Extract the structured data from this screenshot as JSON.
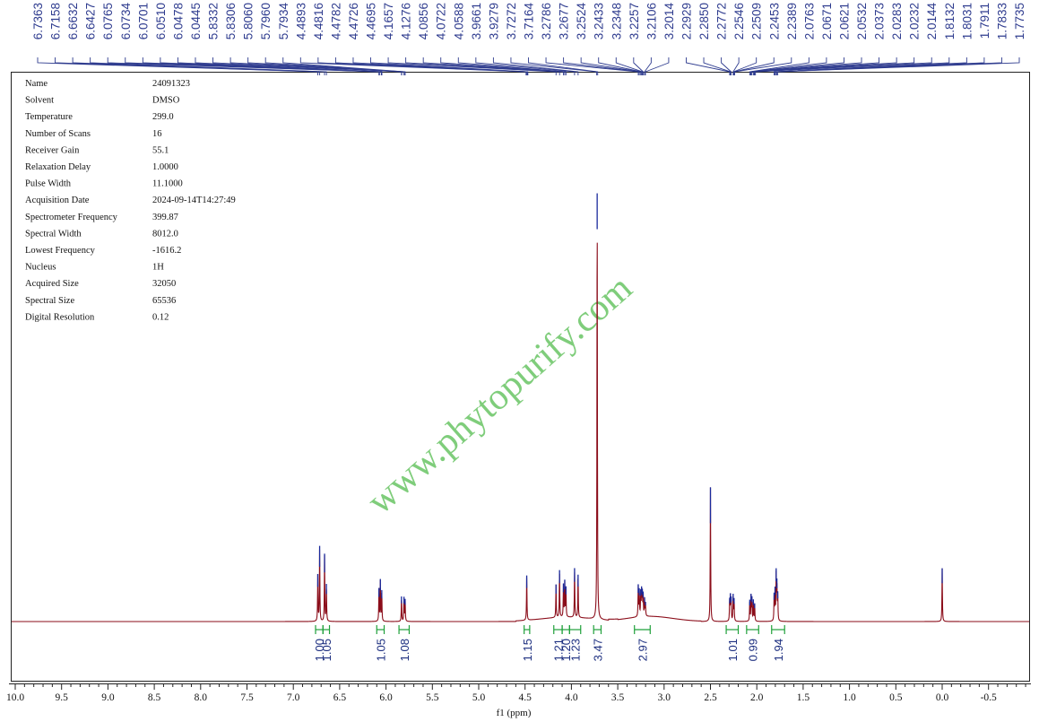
{
  "chart_data": {
    "type": "line",
    "title": "",
    "xlabel": "f1 (ppm)",
    "ylabel": "",
    "x_axis": {
      "range": [
        10.0,
        -1.0
      ],
      "reversed": true,
      "tick_labels": [
        "10.0",
        "9.5",
        "9.0",
        "8.5",
        "8.0",
        "7.5",
        "7.0",
        "6.5",
        "6.0",
        "5.5",
        "5.0",
        "4.5",
        "4.0",
        "3.5",
        "3.0",
        "2.5",
        "2.0",
        "1.5",
        "1.0",
        "0.5",
        "0.0",
        "-0.5"
      ]
    },
    "grid": false,
    "spectrum_color": "#8b0d1a",
    "peak_tip_color": "#1a2a9c",
    "peak_label_color": "#2f3c8f",
    "integration_color": "#1fa03a",
    "peak_labels": [
      "6.7363",
      "6.7158",
      "6.6632",
      "6.6427",
      "6.0765",
      "6.0734",
      "6.0701",
      "6.0510",
      "6.0478",
      "6.0445",
      "5.8332",
      "5.8306",
      "5.8060",
      "5.7960",
      "5.7934",
      "4.4893",
      "4.4816",
      "4.4782",
      "4.4726",
      "4.4695",
      "4.1657",
      "4.1276",
      "4.0856",
      "4.0722",
      "4.0588",
      "3.9661",
      "3.9279",
      "3.7272",
      "3.7164",
      "3.2786",
      "3.2677",
      "3.2524",
      "3.2433",
      "3.2348",
      "3.2257",
      "3.2106",
      "3.2014",
      "2.2929",
      "2.2850",
      "2.2772",
      "2.2546",
      "2.2509",
      "2.2453",
      "2.2389",
      "2.0763",
      "2.0671",
      "2.0621",
      "2.0532",
      "2.0373",
      "2.0283",
      "2.0232",
      "2.0144",
      "1.8132",
      "1.8031",
      "1.7911",
      "1.7833",
      "1.7735"
    ],
    "peaks": [
      {
        "ppm": 6.736,
        "height": 0.108
      },
      {
        "ppm": 6.716,
        "height": 0.175
      },
      {
        "ppm": 6.663,
        "height": 0.157
      },
      {
        "ppm": 6.643,
        "height": 0.085
      },
      {
        "ppm": 6.076,
        "height": 0.075
      },
      {
        "ppm": 6.061,
        "height": 0.095
      },
      {
        "ppm": 6.046,
        "height": 0.07
      },
      {
        "ppm": 5.833,
        "height": 0.058
      },
      {
        "ppm": 5.806,
        "height": 0.055
      },
      {
        "ppm": 5.794,
        "height": 0.05
      },
      {
        "ppm": 4.482,
        "height": 0.105
      },
      {
        "ppm": 4.166,
        "height": 0.077
      },
      {
        "ppm": 4.128,
        "height": 0.11
      },
      {
        "ppm": 4.086,
        "height": 0.075
      },
      {
        "ppm": 4.072,
        "height": 0.082
      },
      {
        "ppm": 4.059,
        "height": 0.068
      },
      {
        "ppm": 3.966,
        "height": 0.115
      },
      {
        "ppm": 3.928,
        "height": 0.1
      },
      {
        "ppm": 3.722,
        "height": 1.0
      },
      {
        "ppm": 3.279,
        "height": 0.072
      },
      {
        "ppm": 3.268,
        "height": 0.06
      },
      {
        "ppm": 3.252,
        "height": 0.055
      },
      {
        "ppm": 3.243,
        "height": 0.058
      },
      {
        "ppm": 3.235,
        "height": 0.052
      },
      {
        "ppm": 3.226,
        "height": 0.05
      },
      {
        "ppm": 3.211,
        "height": 0.04
      },
      {
        "ppm": 3.201,
        "height": 0.03
      },
      {
        "ppm": 2.5,
        "height": 0.315
      },
      {
        "ppm": 2.293,
        "height": 0.048
      },
      {
        "ppm": 2.285,
        "height": 0.055
      },
      {
        "ppm": 2.277,
        "height": 0.05
      },
      {
        "ppm": 2.255,
        "height": 0.06
      },
      {
        "ppm": 2.245,
        "height": 0.05
      },
      {
        "ppm": 2.076,
        "height": 0.048
      },
      {
        "ppm": 2.062,
        "height": 0.058
      },
      {
        "ppm": 2.053,
        "height": 0.052
      },
      {
        "ppm": 2.037,
        "height": 0.048
      },
      {
        "ppm": 2.023,
        "height": 0.04
      },
      {
        "ppm": 1.813,
        "height": 0.06
      },
      {
        "ppm": 1.803,
        "height": 0.07
      },
      {
        "ppm": 1.791,
        "height": 0.11
      },
      {
        "ppm": 1.783,
        "height": 0.082
      },
      {
        "ppm": 1.774,
        "height": 0.06
      },
      {
        "ppm": 0.0,
        "height": 0.125
      }
    ],
    "integrations": [
      {
        "label": "1.00",
        "from": 6.76,
        "to": 6.68
      },
      {
        "label": "1.05",
        "from": 6.68,
        "to": 6.61
      },
      {
        "label": "1.05",
        "from": 6.1,
        "to": 6.02
      },
      {
        "label": "1.08",
        "from": 5.86,
        "to": 5.75
      },
      {
        "label": "1.15",
        "from": 4.51,
        "to": 4.45
      },
      {
        "label": "1.21",
        "from": 4.19,
        "to": 4.1
      },
      {
        "label": "1.20",
        "from": 4.1,
        "to": 4.02
      },
      {
        "label": "1.23",
        "from": 4.02,
        "to": 3.9
      },
      {
        "label": "3.47",
        "from": 3.76,
        "to": 3.68
      },
      {
        "label": "2.97",
        "from": 3.32,
        "to": 3.15
      },
      {
        "label": "1.01",
        "from": 2.33,
        "to": 2.2
      },
      {
        "label": "0.99",
        "from": 2.11,
        "to": 1.98
      },
      {
        "label": "1.94",
        "from": 1.84,
        "to": 1.7
      }
    ]
  },
  "parameters": [
    {
      "name": "Name",
      "value": "24091323"
    },
    {
      "name": "Solvent",
      "value": "DMSO"
    },
    {
      "name": "Temperature",
      "value": "299.0"
    },
    {
      "name": "Number of Scans",
      "value": "16"
    },
    {
      "name": "Receiver Gain",
      "value": "55.1"
    },
    {
      "name": "Relaxation Delay",
      "value": "1.0000"
    },
    {
      "name": "Pulse Width",
      "value": "11.1000"
    },
    {
      "name": "Acquisition Date",
      "value": "2024-09-14T14:27:49"
    },
    {
      "name": "Spectrometer Frequency",
      "value": "399.87"
    },
    {
      "name": "Spectral Width",
      "value": "8012.0"
    },
    {
      "name": "Lowest Frequency",
      "value": "-1616.2"
    },
    {
      "name": "Nucleus",
      "value": "1H"
    },
    {
      "name": "Acquired Size",
      "value": "32050"
    },
    {
      "name": "Spectral Size",
      "value": "65536"
    },
    {
      "name": "Digital Resolution",
      "value": "0.12"
    }
  ],
  "watermark": "www.phytopurify.com"
}
